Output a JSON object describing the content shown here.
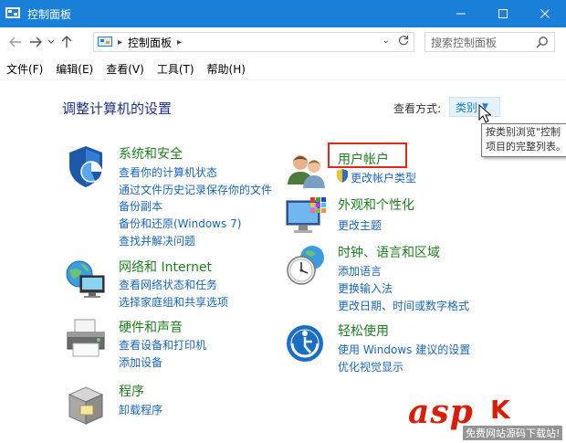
{
  "window": {
    "title": "控制面板"
  },
  "address": {
    "crumb": "控制面板",
    "search_placeholder": "搜索控制面板"
  },
  "menu": [
    "文件(F)",
    "编辑(E)",
    "查看(V)",
    "工具(T)",
    "帮助(H)"
  ],
  "header": {
    "title": "调整计算机的设置",
    "viewby_label": "查看方式:",
    "viewby_value": "类别"
  },
  "tooltip": {
    "line1": "按类别浏览\"控制",
    "line2": "项目的完整列表。"
  },
  "categories": {
    "security": {
      "title": "系统和安全",
      "links": [
        "查看你的计算机状态",
        "通过文件历史记录保存你的文件",
        "备份副本",
        "备份和还原(Windows 7)",
        "查找并解决问题"
      ]
    },
    "network": {
      "title": "网络和 Internet",
      "links": [
        "查看网络状态和任务",
        "选择家庭组和共享选项"
      ]
    },
    "hardware": {
      "title": "硬件和声音",
      "links": [
        "查看设备和打印机",
        "添加设备"
      ]
    },
    "programs": {
      "title": "程序",
      "links": [
        "卸载程序"
      ]
    },
    "accounts": {
      "title": "用户帐户",
      "links": [
        "更改帐户类型"
      ]
    },
    "appearance": {
      "title": "外观和个性化",
      "links": [
        "更改主题"
      ]
    },
    "clock": {
      "title": "时钟、语言和区域",
      "links": [
        "添加语言",
        "更换输入法",
        "更改日期、时间或数字格式"
      ]
    },
    "ease": {
      "title": "轻松使用",
      "links": [
        "使用 Windows 建议的设置",
        "优化视觉显示"
      ]
    }
  },
  "watermark": {
    "brand": "asp",
    "ku": "K",
    "caption": "免费网站源码下载站!"
  },
  "colors": {
    "titlebar": "#1a7fd8",
    "category_title": "#1e7e1e",
    "link": "#1a66b8",
    "highlight": "#e2281b"
  }
}
